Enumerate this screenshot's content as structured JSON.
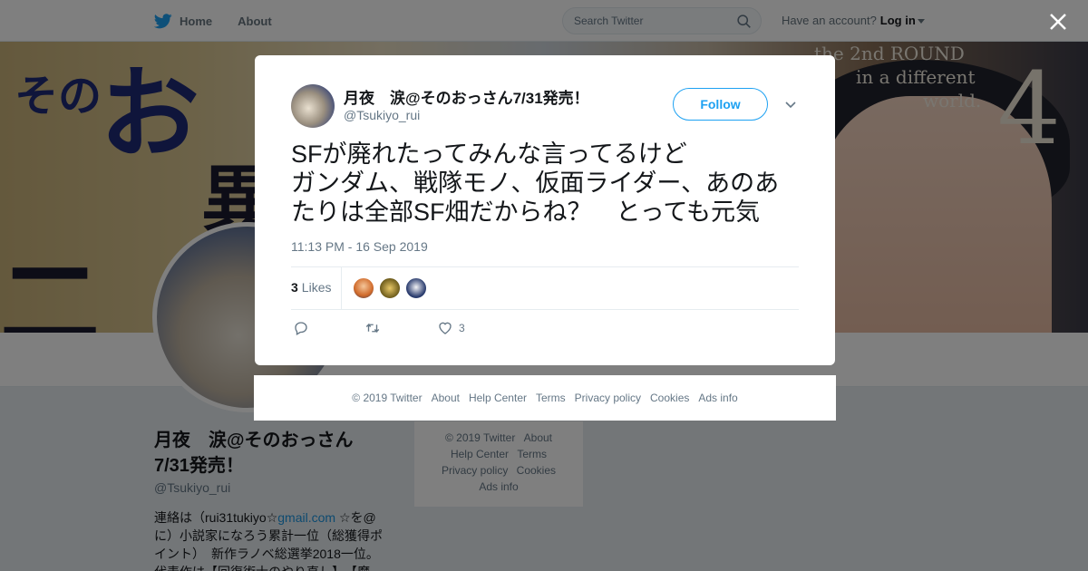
{
  "topbar": {
    "nav": [
      {
        "label": "Home",
        "icon": "twitter-bird-icon"
      },
      {
        "label": "About"
      }
    ],
    "search_placeholder": "Search Twitter",
    "account_prompt": "Have an account?",
    "login_label": "Log in",
    "brand_color": "#1da1f2"
  },
  "banner": {
    "title_line1": "the 2nd ROUND",
    "title_line2": "in a different",
    "title_line3": "world.",
    "volume": "4"
  },
  "profile": {
    "name": "月夜　涙@そのおっさん7/31発売！",
    "handle": "@Tsukiyo_rui",
    "bio_pre": "連絡は（rui31tukiyo☆",
    "bio_link": "gmail.com",
    "bio_post": " ☆を@に）小説家になろう累計一位（総獲得ポイント）　新作ラノベ総選挙2018一位。代表作は【回復術士のやり直し】、【魔"
  },
  "side_footer": {
    "items": [
      "© 2019 Twitter",
      "About",
      "Help Center",
      "Terms",
      "Privacy policy",
      "Cookies",
      "Ads info"
    ]
  },
  "modal": {
    "author_name": "月夜　涙@そのおっさん7/31発売！",
    "author_handle": "@Tsukiyo_rui",
    "follow_label": "Follow",
    "tweet_text": "SFが廃れたってみんな言ってるけど\nガンダム、戦隊モノ、仮面ライダー、あのあたりは全部SF畑だからね？　とっても元気",
    "timestamp": "11:13 PM - 16 Sep 2019",
    "likes_count": "3",
    "likes_label": "Likes",
    "like_action_count": "3"
  },
  "modal_footer": {
    "items": [
      "© 2019 Twitter",
      "About",
      "Help Center",
      "Terms",
      "Privacy policy",
      "Cookies",
      "Ads info"
    ]
  }
}
